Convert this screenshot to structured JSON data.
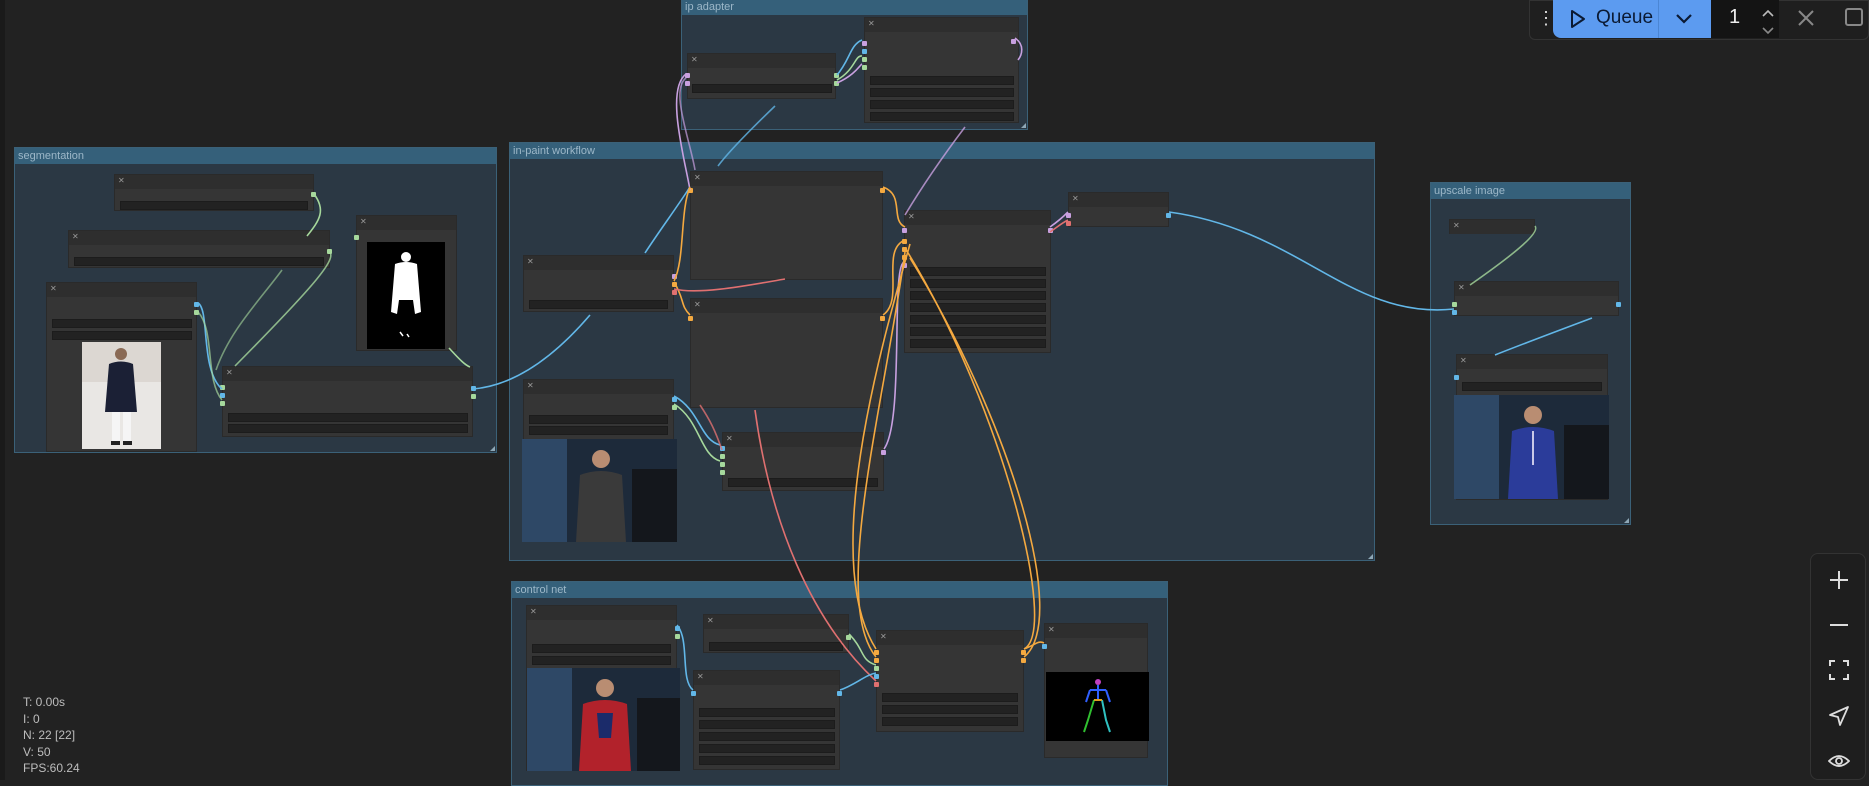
{
  "groups": {
    "ip_adapter": {
      "title": "ip adapter"
    },
    "segmentation": {
      "title": "segmentation"
    },
    "inpaint": {
      "title": "in-paint workflow"
    },
    "upscale": {
      "title": "upscale image"
    },
    "control_net": {
      "title": "control net"
    }
  },
  "toolbar": {
    "queue_label": "Queue",
    "batch_count": "1",
    "drag_handle": "⋮"
  },
  "stats": {
    "t": "T: 0.00s",
    "i": "I: 0",
    "n": "N: 22 [22]",
    "v": "V: 50",
    "fps": "FPS:60.24"
  },
  "icons": {
    "play": "play-icon",
    "chevron": "chevron-down-icon",
    "close": "close-icon",
    "panel": "panel-toggle-icon",
    "zoom_in": "zoom-in-icon",
    "zoom_out": "zoom-out-icon",
    "fit": "fit-view-icon",
    "locate": "locate-icon",
    "eye": "eye-icon"
  },
  "colors": {
    "canvas": "#222222",
    "group_header": "#35607a",
    "queue_button": "#5c9bf0",
    "link_blue": "#62b7e8",
    "link_orange": "#f4a940",
    "link_pink": "#e07070",
    "link_lilac": "#c8a0e0",
    "link_green": "#a6d89c"
  }
}
